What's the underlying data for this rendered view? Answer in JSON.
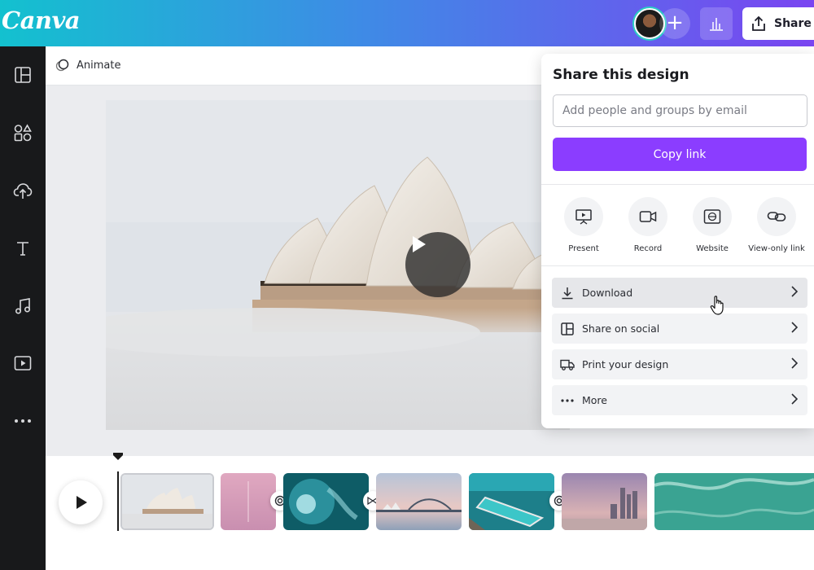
{
  "app": {
    "logo": "Canva"
  },
  "header": {
    "share_label": "Share",
    "avatar_alt": "user-avatar"
  },
  "toolbar": {
    "animate_label": "Animate"
  },
  "share_panel": {
    "title": "Share this design",
    "email_placeholder": "Add people and groups by email",
    "copy_link_label": "Copy link",
    "options": [
      {
        "label": "Present",
        "icon": "present-icon"
      },
      {
        "label": "Record",
        "icon": "record-icon"
      },
      {
        "label": "Website",
        "icon": "website-icon"
      },
      {
        "label": "View-only link",
        "icon": "link-icon"
      }
    ],
    "actions": [
      {
        "label": "Download",
        "icon": "download-icon"
      },
      {
        "label": "Share on social",
        "icon": "social-icon"
      },
      {
        "label": "Print your design",
        "icon": "truck-icon"
      },
      {
        "label": "More",
        "icon": "more-icon"
      }
    ]
  },
  "colors": {
    "brand_purple": "#8b3dff",
    "header_gradient_start": "#13c1cf",
    "header_gradient_end": "#7a45f1",
    "sidebar": "#18191b"
  },
  "sidebar": {
    "items": [
      {
        "icon": "layout-icon"
      },
      {
        "icon": "elements-icon"
      },
      {
        "icon": "upload-icon"
      },
      {
        "icon": "text-icon"
      },
      {
        "icon": "audio-icon"
      },
      {
        "icon": "video-icon"
      },
      {
        "icon": "more-icon"
      }
    ]
  },
  "timeline": {
    "clips": [
      "sydney-opera-house-fog",
      "pink-sky",
      "underwater-swimmer",
      "harbour-bridge",
      "ocean-pool",
      "gold-coast-skyline",
      "ocean-waves"
    ]
  }
}
